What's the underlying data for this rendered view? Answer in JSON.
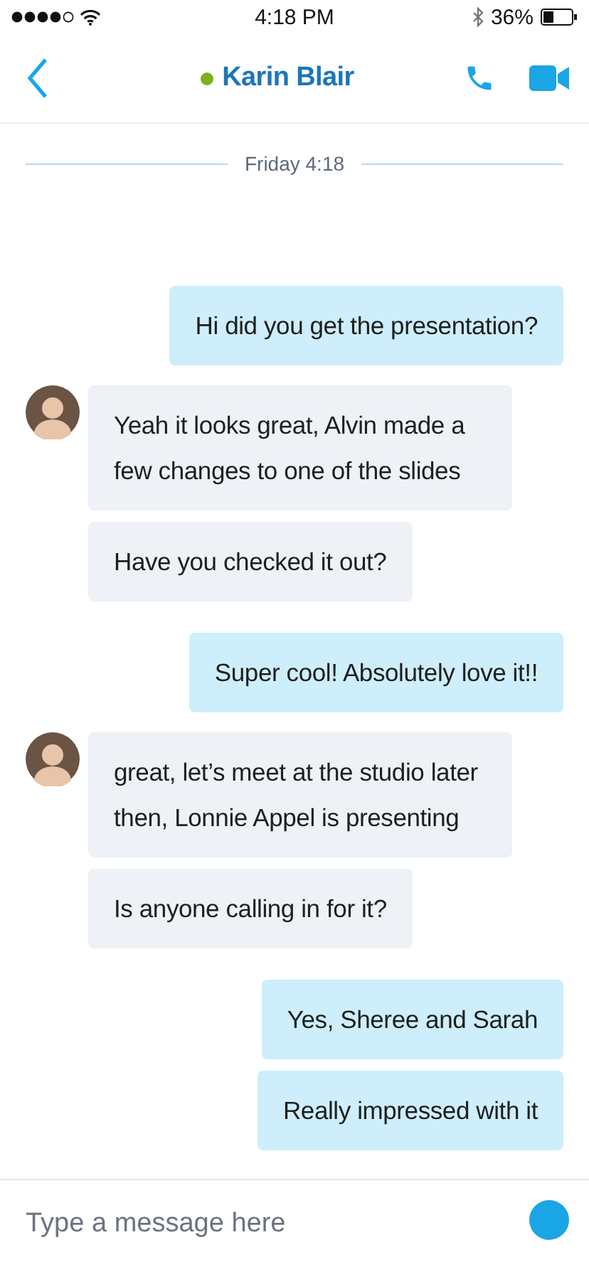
{
  "status_bar": {
    "time": "4:18 PM",
    "battery": "36%"
  },
  "header": {
    "contact": "Karin Blair",
    "online": true
  },
  "date_separator": "Friday 4:18",
  "messages": [
    {
      "kind": "sent",
      "text": "Hi did you get the presentation?"
    },
    {
      "kind": "received",
      "avatar": true,
      "text": "Yeah it looks great, Alvin made a few changes to one of the slides"
    },
    {
      "kind": "received",
      "avatar": false,
      "text": "Have you checked it out?"
    },
    {
      "kind": "sent",
      "text": "Super cool! Absolutely love it!!"
    },
    {
      "kind": "received",
      "avatar": true,
      "text": "great, let’s meet at the studio later then, Lonnie Appel is presenting"
    },
    {
      "kind": "received",
      "avatar": false,
      "text": "Is anyone calling in for it?"
    },
    {
      "kind": "sent",
      "text": "Yes, Sheree and Sarah"
    },
    {
      "kind": "sent",
      "text": "Really impressed with it"
    }
  ],
  "composer": {
    "placeholder": "Type a message here"
  }
}
